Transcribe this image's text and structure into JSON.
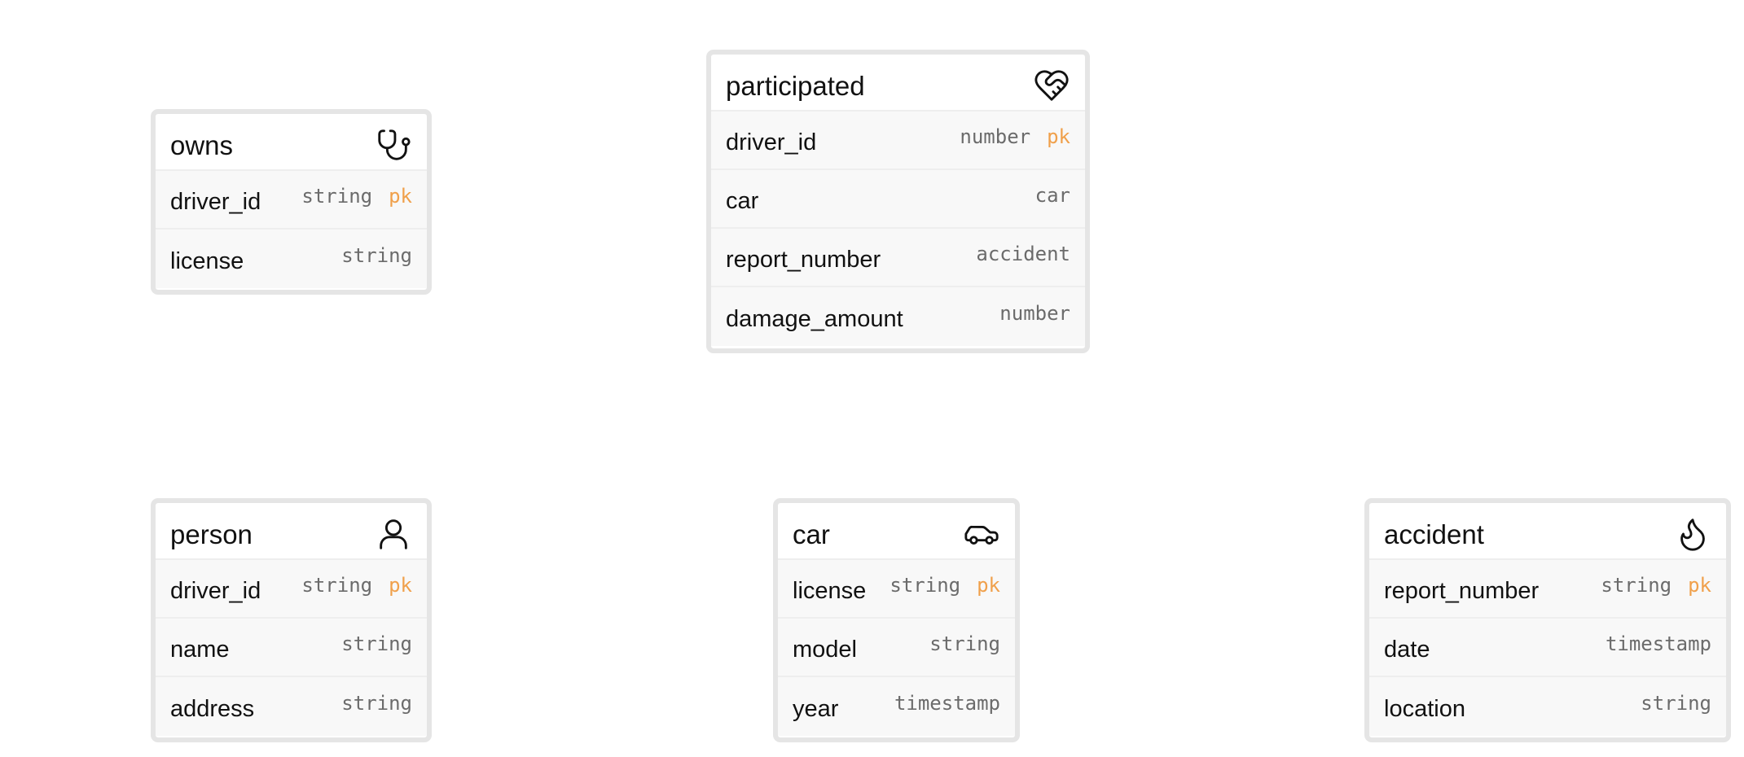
{
  "entities": {
    "owns": {
      "title": "owns",
      "icon": "stethoscope-icon",
      "fields": [
        {
          "name": "driver_id",
          "type": "string",
          "pk": "pk"
        },
        {
          "name": "license",
          "type": "string"
        }
      ]
    },
    "participated": {
      "title": "participated",
      "icon": "heart-handshake-icon",
      "fields": [
        {
          "name": "driver_id",
          "type": "number",
          "pk": "pk"
        },
        {
          "name": "car",
          "type": "car"
        },
        {
          "name": "report_number",
          "type": "accident"
        },
        {
          "name": "damage_amount",
          "type": "number"
        }
      ]
    },
    "person": {
      "title": "person",
      "icon": "user-icon",
      "fields": [
        {
          "name": "driver_id",
          "type": "string",
          "pk": "pk"
        },
        {
          "name": "name",
          "type": "string"
        },
        {
          "name": "address",
          "type": "string"
        }
      ]
    },
    "car": {
      "title": "car",
      "icon": "car-icon",
      "fields": [
        {
          "name": "license",
          "type": "string",
          "pk": "pk"
        },
        {
          "name": "model",
          "type": "string"
        },
        {
          "name": "year",
          "type": "timestamp"
        }
      ]
    },
    "accident": {
      "title": "accident",
      "icon": "flame-icon",
      "fields": [
        {
          "name": "report_number",
          "type": "string",
          "pk": "pk"
        },
        {
          "name": "date",
          "type": "timestamp"
        },
        {
          "name": "location",
          "type": "string"
        }
      ]
    }
  },
  "colors": {
    "border": "#e5e5e5",
    "row_background": "#f8f8f8",
    "type_text": "#6b6b6b",
    "pk_accent": "#f0a04b"
  }
}
